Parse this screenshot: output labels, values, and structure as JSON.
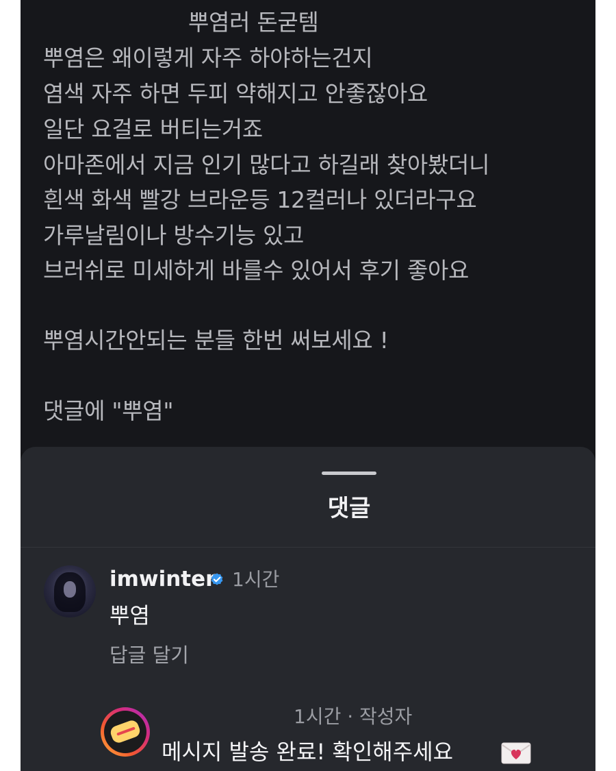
{
  "post": {
    "caption_lines": [
      "뿌염러 돈굳템",
      "뿌염은 왜이렇게 자주 하야하는건지",
      "염색 자주 하면 두피 약해지고 안좋잖아요",
      "일단 요걸로 버티는거죠",
      "아마존에서 지금 인기 많다고 하길래 찾아봤더니",
      "흰색 화색 빨강 브라운등 12컬러나 있더라구요",
      "가루날림이나 방수기능 있고",
      "브러쉬로 미세하게 바를수 있어서 후기 좋아요",
      "뿌염시간안되는 분들 한번 써보세요 !",
      "댓글에 \"뿌염\""
    ]
  },
  "comments_sheet": {
    "title": "댓글",
    "comments": [
      {
        "username": "imwinter",
        "time": "1시간",
        "text": "뿌염",
        "reply_label": "답글 달기",
        "verified": true
      }
    ],
    "reply": {
      "meta": "1시간 · 작성자",
      "text": "메시지 발송 완료! 확인해주세요"
    }
  },
  "colors": {
    "background": "#16171b",
    "sheet": "#26282d",
    "verified": "#3797f0"
  },
  "icons": {
    "verified_badge": "verified-badge-icon",
    "envelope": "love-letter-envelope-icon",
    "drag_handle": "drag-handle-icon"
  }
}
